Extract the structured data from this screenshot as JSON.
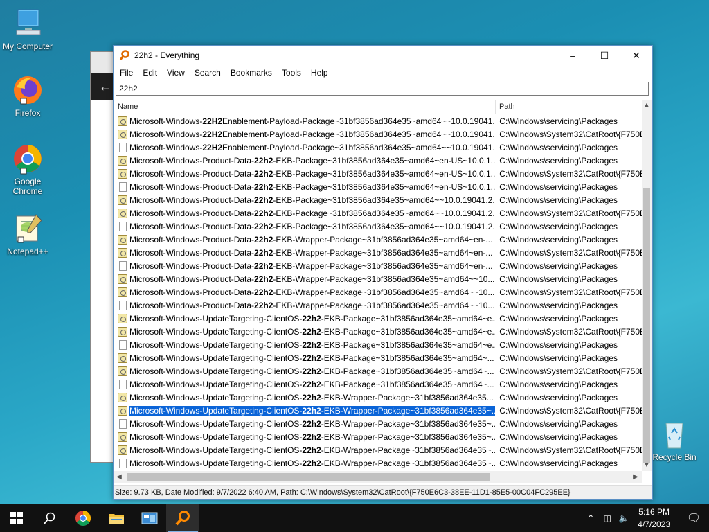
{
  "desktop": {
    "icons": [
      {
        "label": "My Computer"
      },
      {
        "label": "Firefox"
      },
      {
        "label": "Google Chrome"
      },
      {
        "label": "Notepad++"
      },
      {
        "label": "Recycle Bin"
      }
    ]
  },
  "window": {
    "title": "22h2 - Everything",
    "menu": [
      "File",
      "Edit",
      "View",
      "Search",
      "Bookmarks",
      "Tools",
      "Help"
    ],
    "search_value": "22h2",
    "columns": {
      "name": "Name",
      "path": "Path"
    },
    "rows": [
      {
        "icon": "package",
        "pre": "Microsoft-Windows-",
        "hl": "22H2",
        "post": "Enablement-Payload-Package~31bf3856ad364e35~amd64~~10.0.19041...",
        "path": "C:\\Windows\\servicing\\Packages"
      },
      {
        "icon": "package",
        "pre": "Microsoft-Windows-",
        "hl": "22H2",
        "post": "Enablement-Payload-Package~31bf3856ad364e35~amd64~~10.0.19041...",
        "path": "C:\\Windows\\System32\\CatRoot\\{F750E"
      },
      {
        "icon": "file",
        "pre": "Microsoft-Windows-",
        "hl": "22H2",
        "post": "Enablement-Payload-Package~31bf3856ad364e35~amd64~~10.0.19041...",
        "path": "C:\\Windows\\servicing\\Packages"
      },
      {
        "icon": "package",
        "pre": "Microsoft-Windows-Product-Data-",
        "hl": "22h2",
        "post": "-EKB-Package~31bf3856ad364e35~amd64~en-US~10.0.1...",
        "path": "C:\\Windows\\servicing\\Packages"
      },
      {
        "icon": "package",
        "pre": "Microsoft-Windows-Product-Data-",
        "hl": "22h2",
        "post": "-EKB-Package~31bf3856ad364e35~amd64~en-US~10.0.1...",
        "path": "C:\\Windows\\System32\\CatRoot\\{F750E"
      },
      {
        "icon": "file",
        "pre": "Microsoft-Windows-Product-Data-",
        "hl": "22h2",
        "post": "-EKB-Package~31bf3856ad364e35~amd64~en-US~10.0.1...",
        "path": "C:\\Windows\\servicing\\Packages"
      },
      {
        "icon": "package",
        "pre": "Microsoft-Windows-Product-Data-",
        "hl": "22h2",
        "post": "-EKB-Package~31bf3856ad364e35~amd64~~10.0.19041.2...",
        "path": "C:\\Windows\\servicing\\Packages"
      },
      {
        "icon": "package",
        "pre": "Microsoft-Windows-Product-Data-",
        "hl": "22h2",
        "post": "-EKB-Package~31bf3856ad364e35~amd64~~10.0.19041.2...",
        "path": "C:\\Windows\\System32\\CatRoot\\{F750E"
      },
      {
        "icon": "file",
        "pre": "Microsoft-Windows-Product-Data-",
        "hl": "22h2",
        "post": "-EKB-Package~31bf3856ad364e35~amd64~~10.0.19041.2...",
        "path": "C:\\Windows\\servicing\\Packages"
      },
      {
        "icon": "package",
        "pre": "Microsoft-Windows-Product-Data-",
        "hl": "22h2",
        "post": "-EKB-Wrapper-Package~31bf3856ad364e35~amd64~en-...",
        "path": "C:\\Windows\\servicing\\Packages"
      },
      {
        "icon": "package",
        "pre": "Microsoft-Windows-Product-Data-",
        "hl": "22h2",
        "post": "-EKB-Wrapper-Package~31bf3856ad364e35~amd64~en-...",
        "path": "C:\\Windows\\System32\\CatRoot\\{F750E"
      },
      {
        "icon": "file",
        "pre": "Microsoft-Windows-Product-Data-",
        "hl": "22h2",
        "post": "-EKB-Wrapper-Package~31bf3856ad364e35~amd64~en-...",
        "path": "C:\\Windows\\servicing\\Packages"
      },
      {
        "icon": "package",
        "pre": "Microsoft-Windows-Product-Data-",
        "hl": "22h2",
        "post": "-EKB-Wrapper-Package~31bf3856ad364e35~amd64~~10...",
        "path": "C:\\Windows\\servicing\\Packages"
      },
      {
        "icon": "package",
        "pre": "Microsoft-Windows-Product-Data-",
        "hl": "22h2",
        "post": "-EKB-Wrapper-Package~31bf3856ad364e35~amd64~~10...",
        "path": "C:\\Windows\\System32\\CatRoot\\{F750E"
      },
      {
        "icon": "file",
        "pre": "Microsoft-Windows-Product-Data-",
        "hl": "22h2",
        "post": "-EKB-Wrapper-Package~31bf3856ad364e35~amd64~~10...",
        "path": "C:\\Windows\\servicing\\Packages"
      },
      {
        "icon": "package",
        "pre": "Microsoft-Windows-UpdateTargeting-ClientOS-",
        "hl": "22h2",
        "post": "-EKB-Package~31bf3856ad364e35~amd64~e...",
        "path": "C:\\Windows\\servicing\\Packages"
      },
      {
        "icon": "package",
        "pre": "Microsoft-Windows-UpdateTargeting-ClientOS-",
        "hl": "22h2",
        "post": "-EKB-Package~31bf3856ad364e35~amd64~e...",
        "path": "C:\\Windows\\System32\\CatRoot\\{F750E"
      },
      {
        "icon": "file",
        "pre": "Microsoft-Windows-UpdateTargeting-ClientOS-",
        "hl": "22h2",
        "post": "-EKB-Package~31bf3856ad364e35~amd64~e...",
        "path": "C:\\Windows\\servicing\\Packages"
      },
      {
        "icon": "package",
        "pre": "Microsoft-Windows-UpdateTargeting-ClientOS-",
        "hl": "22h2",
        "post": "-EKB-Package~31bf3856ad364e35~amd64~...",
        "path": "C:\\Windows\\servicing\\Packages"
      },
      {
        "icon": "package",
        "pre": "Microsoft-Windows-UpdateTargeting-ClientOS-",
        "hl": "22h2",
        "post": "-EKB-Package~31bf3856ad364e35~amd64~...",
        "path": "C:\\Windows\\System32\\CatRoot\\{F750E"
      },
      {
        "icon": "file",
        "pre": "Microsoft-Windows-UpdateTargeting-ClientOS-",
        "hl": "22h2",
        "post": "-EKB-Package~31bf3856ad364e35~amd64~...",
        "path": "C:\\Windows\\servicing\\Packages"
      },
      {
        "icon": "package",
        "pre": "Microsoft-Windows-UpdateTargeting-ClientOS-",
        "hl": "22h2",
        "post": "-EKB-Wrapper-Package~31bf3856ad364e35...",
        "path": "C:\\Windows\\servicing\\Packages"
      },
      {
        "icon": "package",
        "pre": "Microsoft-Windows-UpdateTargeting-ClientOS-",
        "hl": "22h2",
        "post": "-EKB-Wrapper-Package~31bf3856ad364e35~...",
        "path": "C:\\Windows\\System32\\CatRoot\\{F750E",
        "selected": true
      },
      {
        "icon": "file",
        "pre": "Microsoft-Windows-UpdateTargeting-ClientOS-",
        "hl": "22h2",
        "post": "-EKB-Wrapper-Package~31bf3856ad364e35~...",
        "path": "C:\\Windows\\servicing\\Packages"
      },
      {
        "icon": "package",
        "pre": "Microsoft-Windows-UpdateTargeting-ClientOS-",
        "hl": "22h2",
        "post": "-EKB-Wrapper-Package~31bf3856ad364e35~...",
        "path": "C:\\Windows\\servicing\\Packages"
      },
      {
        "icon": "package",
        "pre": "Microsoft-Windows-UpdateTargeting-ClientOS-",
        "hl": "22h2",
        "post": "-EKB-Wrapper-Package~31bf3856ad364e35~...",
        "path": "C:\\Windows\\System32\\CatRoot\\{F750E"
      },
      {
        "icon": "file",
        "pre": "Microsoft-Windows-UpdateTargeting-ClientOS-",
        "hl": "22h2",
        "post": "-EKB-Wrapper-Package~31bf3856ad364e35~...",
        "path": "C:\\Windows\\servicing\\Packages"
      }
    ],
    "status": "Size: 9.73 KB, Date Modified: 9/7/2022 6:40 AM, Path: C:\\Windows\\System32\\CatRoot\\{F750E6C3-38EE-11D1-85E5-00C04FC295EE}"
  },
  "taskbar": {
    "time": "5:16 PM",
    "date": "4/7/2023",
    "accent": "#7fb2e6"
  }
}
